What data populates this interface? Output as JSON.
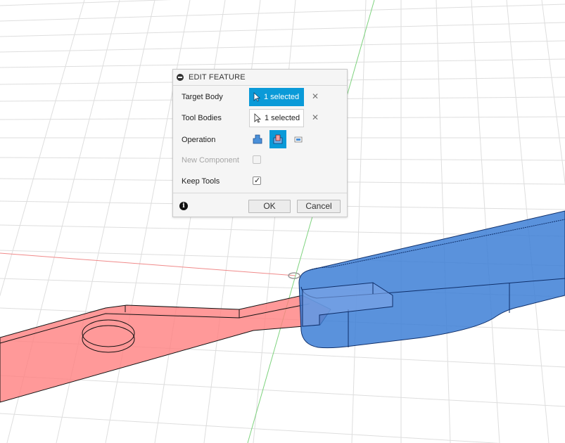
{
  "dialog": {
    "title": "EDIT FEATURE",
    "rows": {
      "target_body": {
        "label": "Target Body",
        "value": "1 selected",
        "active": true
      },
      "tool_bodies": {
        "label": "Tool Bodies",
        "value": "1 selected",
        "active": false
      },
      "operation": {
        "label": "Operation",
        "options": [
          "join-icon",
          "cut-icon",
          "intersect-icon"
        ],
        "selected": "cut-icon"
      },
      "new_component": {
        "label": "New Component",
        "checked": false,
        "disabled": true
      },
      "keep_tools": {
        "label": "Keep Tools",
        "checked": true,
        "disabled": false
      }
    },
    "clear_symbol": "✕",
    "check_symbol": "✓",
    "info_symbol": "i",
    "ok_label": "OK",
    "cancel_label": "Cancel"
  },
  "viewport": {
    "grid_color": "#dcdcdc",
    "x_axis_color": "#f08a8a",
    "y_axis_color": "#7fd37f",
    "target_body_color": "#3d7fd6",
    "tool_body_color": "#ff8a8a"
  },
  "colors": {
    "accent": "#0a9ad8"
  }
}
